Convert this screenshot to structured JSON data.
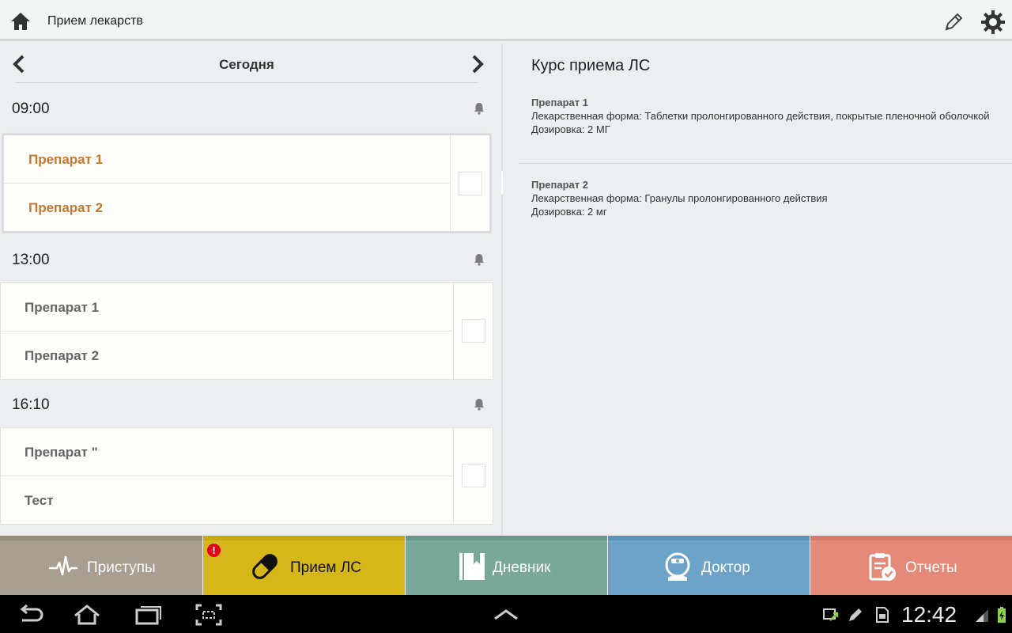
{
  "app": {
    "title": "Прием лекарств"
  },
  "icons": {
    "home": "home-icon",
    "edit": "pencil-icon",
    "settings": "gear-icon",
    "bell": "bell-icon"
  },
  "schedule": {
    "day_label": "Сегодня",
    "slots": [
      {
        "time": "09:00",
        "items": [
          "Препарат 1",
          "Препарат 2"
        ],
        "selected": true
      },
      {
        "time": "13:00",
        "items": [
          "Препарат 1",
          "Препарат 2"
        ],
        "selected": false
      },
      {
        "time": "16:10",
        "items": [
          "Препарат \"",
          "Тест"
        ],
        "selected": false
      }
    ]
  },
  "detail": {
    "heading": "Курс приема ЛС",
    "drugs": [
      {
        "name": "Препарат 1",
        "form": "Лекарственная форма: Таблетки пролонгированного действия, покрытые пленочной оболочкой",
        "dose": "Дозировка: 2 МГ"
      },
      {
        "name": "Препарат 2",
        "form": "Лекарственная форма: Гранулы пролонгированного действия",
        "dose": "Дозировка: 2 мг"
      }
    ]
  },
  "tabs": [
    {
      "label": "Приступы",
      "icon": "pulse-icon"
    },
    {
      "label": "Прием ЛС",
      "icon": "pill-icon",
      "badge": "!",
      "active": true
    },
    {
      "label": "Дневник",
      "icon": "book-icon"
    },
    {
      "label": "Доктор",
      "icon": "doctor-icon"
    },
    {
      "label": "Отчеты",
      "icon": "report-icon"
    }
  ],
  "system": {
    "clock": "12:42"
  },
  "colors": {
    "accent_selected_text": "#c8772c",
    "tab_attacks": "#a99e8f",
    "tab_meds": "#d6b71a",
    "tab_diary": "#7aa898",
    "tab_doctor": "#6ea3c9",
    "tab_reports": "#e58a78"
  }
}
